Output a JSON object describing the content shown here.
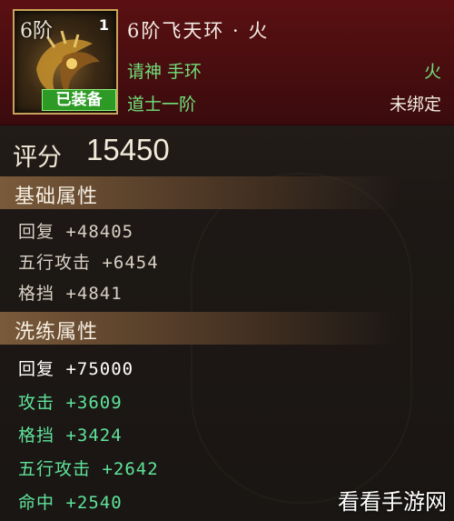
{
  "header": {
    "icon": {
      "tier_text": "6阶",
      "count": "1",
      "badge": "已装备"
    },
    "title": "6阶飞天环 · 火",
    "rows": [
      {
        "left": "请神 手环",
        "right": "火"
      },
      {
        "left": "道士一阶",
        "right": "未绑定"
      }
    ]
  },
  "score": {
    "label": "评分",
    "value": "15450"
  },
  "basic": {
    "title": "基础属性",
    "items": [
      {
        "text": "回复 +48405"
      },
      {
        "text": "五行攻击 +6454"
      },
      {
        "text": "格挡 +4841"
      }
    ]
  },
  "refine": {
    "title": "洗练属性",
    "items": [
      {
        "text": "回复 +75000",
        "color": "#ffffff"
      },
      {
        "text": "攻击 +3609",
        "color": "#5fe39a"
      },
      {
        "text": "格挡 +3424",
        "color": "#5fe39a"
      },
      {
        "text": "五行攻击 +2642",
        "color": "#5fe39a"
      },
      {
        "text": "命中 +2540",
        "color": "#5fe39a"
      }
    ]
  },
  "watermark": "看看手游网"
}
